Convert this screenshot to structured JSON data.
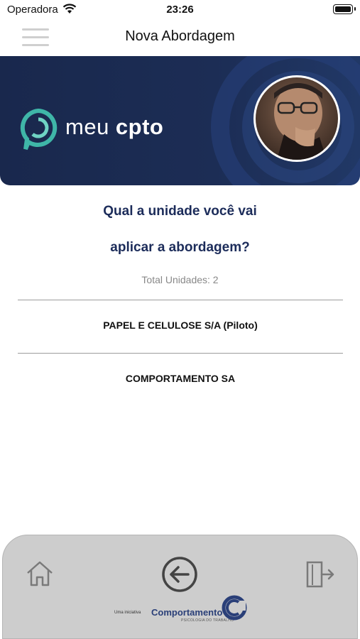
{
  "status_bar": {
    "carrier": "Operadora",
    "time": "23:26"
  },
  "nav": {
    "title": "Nova Abordagem"
  },
  "banner": {
    "brand_light": "meu ",
    "brand_bold": "cpto",
    "colors": {
      "background": "#1c2d55",
      "accent": "#3fb6a8"
    }
  },
  "question": {
    "line1": "Qual a unidade você vai",
    "line2": "aplicar a abordagem?"
  },
  "total_units": "Total Unidades: 2",
  "units": [
    {
      "label": "PAPEL E CELULOSE S/A (Piloto)"
    },
    {
      "label": "COMPORTAMENTO SA"
    }
  ],
  "footer": {
    "prefix": "Uma iniciativa",
    "brand": "Comportamento",
    "sub": "PSICOLOGIA DO TRABALHO"
  },
  "icons": {
    "home": "home-icon",
    "back": "back-arrow-icon",
    "exit": "exit-door-icon",
    "menu": "hamburger-menu-icon"
  }
}
